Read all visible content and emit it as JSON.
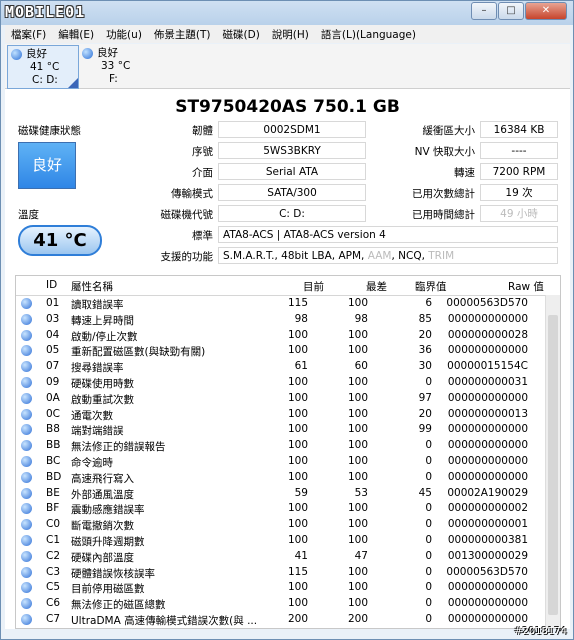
{
  "window": {
    "logo": "MOBILE01",
    "btn_min": "–",
    "btn_max": "□",
    "btn_close": "✕"
  },
  "menu": [
    "檔案(F)",
    "編輯(E)",
    "功能(u)",
    "佈景主題(T)",
    "磁碟(D)",
    "說明(H)",
    "語言(L)(Language)"
  ],
  "disks": [
    {
      "status": "良好",
      "temp": "41 °C",
      "drive": "C: D:"
    },
    {
      "status": "良好",
      "temp": "33 °C",
      "drive": "F:"
    }
  ],
  "model": "ST9750420AS  750.1 GB",
  "health": {
    "label": "磁碟健康狀態",
    "value": "良好"
  },
  "temperature": {
    "label": "溫度",
    "value": "41 °C"
  },
  "info_left": [
    {
      "label": "韌體",
      "value": "0002SDM1"
    },
    {
      "label": "序號",
      "value": "5WS3BKRY"
    },
    {
      "label": "介面",
      "value": "Serial ATA"
    },
    {
      "label": "傳輸模式",
      "value": "SATA/300"
    },
    {
      "label": "磁碟機代號",
      "value": "C: D:"
    }
  ],
  "info_right": [
    {
      "label": "緩衝區大小",
      "value": "16384 KB"
    },
    {
      "label": "NV 快取大小",
      "value": "----"
    },
    {
      "label": "轉速",
      "value": "7200 RPM"
    },
    {
      "label": "已用次數總計",
      "value": "19 次"
    },
    {
      "label": "已用時間總計",
      "value": "49 小時"
    }
  ],
  "standard": {
    "label": "標準",
    "value": "ATA8-ACS | ATA8-ACS version 4"
  },
  "features": {
    "label": "支援的功能",
    "value": "S.M.A.R.T., 48bit LBA, APM, ",
    "aam": "AAM",
    "sep": ", NCQ, ",
    "trim": "TRIM"
  },
  "table": {
    "headers": [
      "ID",
      "屬性名稱",
      "目前",
      "最差",
      "臨界值",
      "Raw 值"
    ],
    "rows": [
      [
        "01",
        "讀取錯誤率",
        "115",
        "100",
        "6",
        "00000563D570"
      ],
      [
        "03",
        "轉速上昇時間",
        "98",
        "98",
        "85",
        "000000000000"
      ],
      [
        "04",
        "啟動/停止次數",
        "100",
        "100",
        "20",
        "000000000028"
      ],
      [
        "05",
        "重新配置磁區數(與缺勁有關)",
        "100",
        "100",
        "36",
        "000000000000"
      ],
      [
        "07",
        "搜尋錯誤率",
        "61",
        "60",
        "30",
        "00000015154C"
      ],
      [
        "09",
        "硬碟使用時數",
        "100",
        "100",
        "0",
        "000000000031"
      ],
      [
        "0A",
        "啟動重試次數",
        "100",
        "100",
        "97",
        "000000000000"
      ],
      [
        "0C",
        "通電次數",
        "100",
        "100",
        "20",
        "000000000013"
      ],
      [
        "B8",
        "端對端錯誤",
        "100",
        "100",
        "99",
        "000000000000"
      ],
      [
        "BB",
        "無法修正的錯誤報告",
        "100",
        "100",
        "0",
        "000000000000"
      ],
      [
        "BC",
        "命令逾時",
        "100",
        "100",
        "0",
        "000000000000"
      ],
      [
        "BD",
        "高速飛行寫入",
        "100",
        "100",
        "0",
        "000000000000"
      ],
      [
        "BE",
        "外部通風溫度",
        "59",
        "53",
        "45",
        "00002A190029"
      ],
      [
        "BF",
        "震動感應錯誤率",
        "100",
        "100",
        "0",
        "000000000002"
      ],
      [
        "C0",
        "斷電撤銷次數",
        "100",
        "100",
        "0",
        "000000000001"
      ],
      [
        "C1",
        "磁頭升降週期數",
        "100",
        "100",
        "0",
        "000000000381"
      ],
      [
        "C2",
        "硬碟內部溫度",
        "41",
        "47",
        "0",
        "001300000029"
      ],
      [
        "C3",
        "硬體錯誤恢核誤率",
        "115",
        "100",
        "0",
        "00000563D570"
      ],
      [
        "C5",
        "目前停用磁區數",
        "100",
        "100",
        "0",
        "000000000000"
      ],
      [
        "C6",
        "無法修正的磁區總數",
        "100",
        "100",
        "0",
        "000000000000"
      ],
      [
        "C7",
        "UltraDMA 高速傳輸模式錯誤次數(與 ...",
        "200",
        "200",
        "0",
        "000000000000"
      ]
    ]
  },
  "watermark": "#2018174"
}
